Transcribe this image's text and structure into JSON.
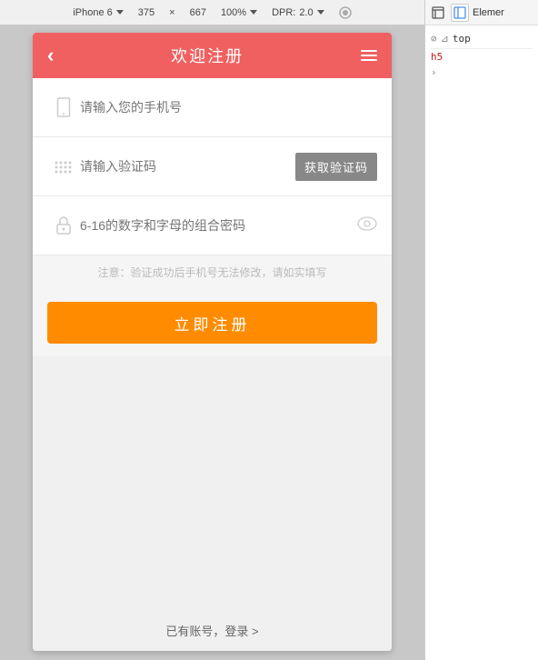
{
  "browser_toolbar": {
    "device": "iPhone 6",
    "width": "375",
    "x": "×",
    "height": "667",
    "zoom": "100%",
    "dpr_label": "DPR:",
    "dpr_value": "2.0"
  },
  "app": {
    "header": {
      "back_label": "‹",
      "title": "欢迎注册",
      "menu_aria": "menu"
    },
    "form": {
      "phone_placeholder": "请输入您的手机号",
      "verify_placeholder": "请输入验证码",
      "verify_btn_label": "获取验证码",
      "password_placeholder": "6-16的数字和字母的组合密码",
      "notice": "注意：验证成功后手机号无法修改，请如实填写",
      "register_btn_label": "立即注册"
    },
    "footer": {
      "login_link": "已有账号，登录 >"
    }
  },
  "devtools": {
    "tab_label": "Elemer",
    "filter_icon": "🚫",
    "filter_text": "top",
    "element_h5": "h5",
    "arrow": "›"
  }
}
